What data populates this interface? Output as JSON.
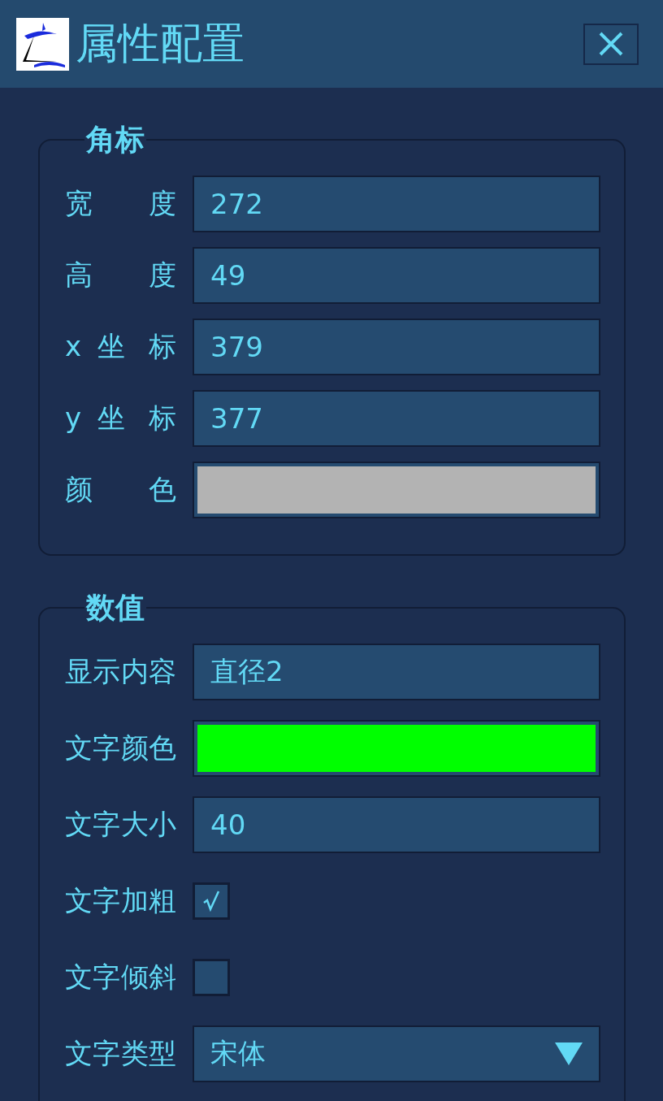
{
  "window": {
    "title": "属性配置"
  },
  "sections": [
    {
      "title": "角标",
      "fields": [
        {
          "label": "宽 度",
          "kind": "text",
          "value": "272"
        },
        {
          "label": "高 度",
          "kind": "text",
          "value": "49"
        },
        {
          "label": "x 坐 标",
          "kind": "text",
          "value": "379"
        },
        {
          "label": "y 坐 标",
          "kind": "text",
          "value": "377"
        },
        {
          "label": "颜 色",
          "kind": "color",
          "color": "#b3b3b3"
        }
      ]
    },
    {
      "title": "数值",
      "fields": [
        {
          "label": "显示内容",
          "kind": "text",
          "value": "直径2"
        },
        {
          "label": "文字颜色",
          "kind": "color",
          "color": "#00ff00"
        },
        {
          "label": "文字大小",
          "kind": "text",
          "value": "40"
        },
        {
          "label": "文字加粗",
          "kind": "checkbox",
          "checked": true
        },
        {
          "label": "文字倾斜",
          "kind": "checkbox",
          "checked": false
        },
        {
          "label": "文字类型",
          "kind": "select",
          "value": "宋体"
        }
      ]
    }
  ]
}
